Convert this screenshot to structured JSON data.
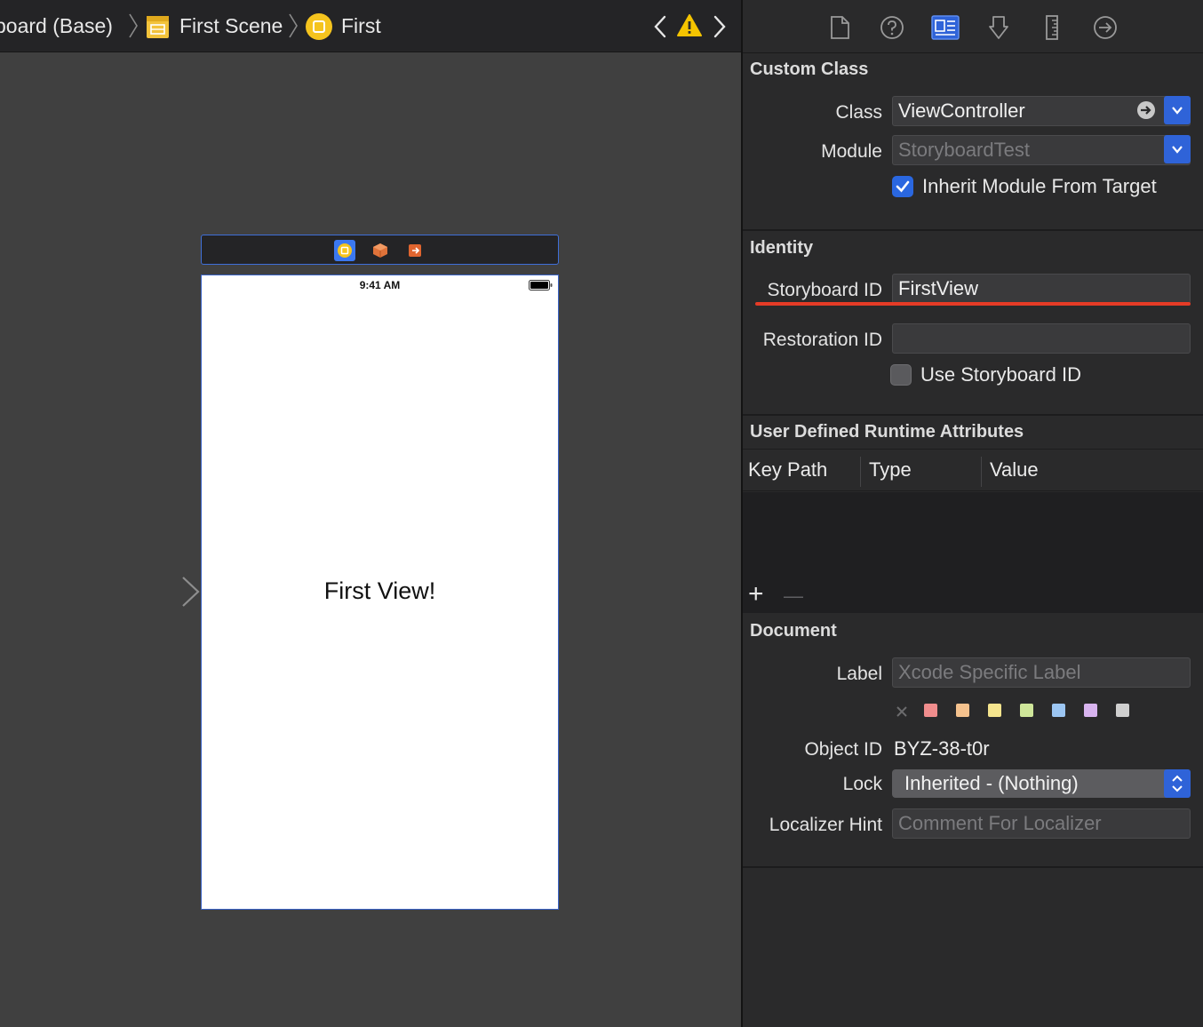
{
  "breadcrumb": {
    "storyboard": "board (Base)",
    "scene": "First Scene",
    "controller": "First"
  },
  "canvas": {
    "status_time": "9:41 AM",
    "view_label": "First View!"
  },
  "inspector": {
    "custom_class": {
      "title": "Custom Class",
      "class_label": "Class",
      "class_value": "ViewController",
      "module_label": "Module",
      "module_placeholder": "StoryboardTest",
      "inherit_label": "Inherit Module From Target",
      "inherit_checked": true
    },
    "identity": {
      "title": "Identity",
      "storyboard_id_label": "Storyboard ID",
      "storyboard_id_value": "FirstView",
      "restoration_id_label": "Restoration ID",
      "restoration_id_value": "",
      "use_storyboard_id_label": "Use Storyboard ID",
      "use_storyboard_id_checked": false
    },
    "runtime_attributes": {
      "title": "User Defined Runtime Attributes",
      "columns": [
        "Key Path",
        "Type",
        "Value"
      ],
      "add_symbol": "+",
      "remove_symbol": "—"
    },
    "document": {
      "title": "Document",
      "label_label": "Label",
      "label_placeholder": "Xcode Specific Label",
      "label_colors": [
        "#f08d8d",
        "#f5c28e",
        "#f4e48d",
        "#cfe69a",
        "#9cc6f3",
        "#d8b4ef",
        "#cfcfcf"
      ],
      "object_id_label": "Object ID",
      "object_id_value": "BYZ-38-t0r",
      "lock_label": "Lock",
      "lock_value": "Inherited - (Nothing)",
      "localizer_label": "Localizer Hint",
      "localizer_placeholder": "Comment For Localizer"
    }
  },
  "colors": {
    "accent": "#2f63d8",
    "highlight_underline": "#e53b26",
    "warning": "#f5c400"
  }
}
